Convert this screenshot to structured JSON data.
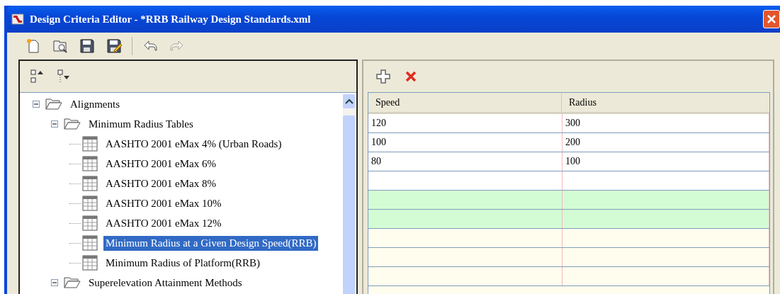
{
  "window": {
    "title": "Design Criteria Editor - *RRB Railway Design Standards.xml"
  },
  "toolbar": [
    {
      "kind": "new"
    },
    {
      "kind": "open"
    },
    {
      "kind": "save"
    },
    {
      "kind": "saveas"
    },
    {
      "kind": "sep"
    },
    {
      "kind": "undo",
      "disabled": false
    },
    {
      "kind": "redo",
      "disabled": true
    }
  ],
  "tree_toolbar": [
    {
      "kind": "collapse"
    },
    {
      "kind": "expand"
    }
  ],
  "tree": [
    {
      "label": "Alignments",
      "kind": "folder",
      "expanded": true,
      "selected": false,
      "children": [
        {
          "label": "Minimum Radius Tables",
          "kind": "folder",
          "expanded": true,
          "selected": false,
          "children": [
            {
              "label": "AASHTO 2001 eMax 4% (Urban Roads)",
              "kind": "table",
              "selected": false
            },
            {
              "label": "AASHTO 2001 eMax 6%",
              "kind": "table",
              "selected": false
            },
            {
              "label": "AASHTO 2001 eMax 8%",
              "kind": "table",
              "selected": false
            },
            {
              "label": "AASHTO 2001 eMax 10%",
              "kind": "table",
              "selected": false
            },
            {
              "label": "AASHTO 2001 eMax 12%",
              "kind": "table",
              "selected": false
            },
            {
              "label": "Minimum Radius at a Given Design Speed(RRB)",
              "kind": "table",
              "selected": true
            },
            {
              "label": "Minimum Radius of Platform(RRB)",
              "kind": "table",
              "selected": false
            }
          ]
        },
        {
          "label": "Superelevation Attainment Methods",
          "kind": "folder",
          "expanded": true,
          "selected": false
        }
      ]
    }
  ],
  "grid": {
    "columns": [
      "Speed",
      "Radius"
    ],
    "rows": [
      {
        "cells": [
          "120",
          "300"
        ],
        "color": "#ffffff"
      },
      {
        "cells": [
          "100",
          "200"
        ],
        "color": "#ffffff"
      },
      {
        "cells": [
          "80",
          "100"
        ],
        "color": "#ffffff"
      },
      {
        "color": "#ffffff"
      },
      {
        "color": "#d4fcd4"
      },
      {
        "color": "#d4fcd4"
      },
      {
        "color": "#fffdee"
      },
      {
        "color": "#fffdee"
      },
      {
        "color": "#fffdee"
      }
    ]
  }
}
